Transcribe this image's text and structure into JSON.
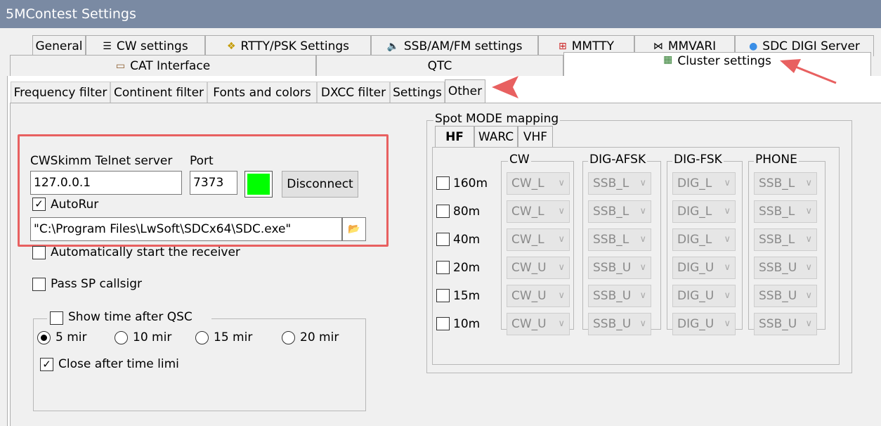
{
  "window": {
    "title": "5MContest Settings"
  },
  "tabs_row1": [
    {
      "label": "General",
      "icon": "",
      "icon_name": ""
    },
    {
      "label": "CW settings",
      "icon": "☰",
      "icon_name": "cw-settings-icon"
    },
    {
      "label": "RTTY/PSK Settings",
      "icon": "❖",
      "icon_name": "rtty-psk-icon"
    },
    {
      "label": "SSB/AM/FM settings",
      "icon": "🔈",
      "icon_name": "speaker-icon"
    },
    {
      "label": "MMTTY",
      "icon": "⊞",
      "icon_name": "mmtty-icon"
    },
    {
      "label": "MMVARI",
      "icon": "⋈",
      "icon_name": "mmvari-icon"
    },
    {
      "label": "SDC DIGI Server",
      "icon": "●",
      "icon_name": "sdc-digi-icon"
    }
  ],
  "tabs_row2": [
    {
      "label": "CAT Interface",
      "icon": "▭",
      "icon_name": "cat-interface-icon"
    },
    {
      "label": "QTC",
      "icon": "",
      "icon_name": ""
    },
    {
      "label": "Cluster settings",
      "icon": "▦",
      "icon_name": "cluster-settings-icon"
    }
  ],
  "subtabs": [
    "Frequency filter",
    "Continent filter",
    "Fonts and colors",
    "DXCC filter",
    "Settings",
    "Other"
  ],
  "other": {
    "server_label": "CWSkimm Telnet server",
    "port_label": "Port",
    "server_value": "127.0.0.1",
    "port_value": "7373",
    "status_color": "#00ff00",
    "disconnect_label": "Disconnect",
    "autorun_label": "AutoRur",
    "autorun_checked": "✓",
    "exe_path": "\"C:\\Program Files\\LwSoft\\SDCx64\\SDC.exe\"",
    "folder_icon": "📂",
    "auto_start_label": "Automatically start the receiver",
    "pass_sp_label": "Pass SP callsigr",
    "show_time_label": "Show time after QSC",
    "radio_options": [
      "5 mir",
      "10 mir",
      "15 mir",
      "20 mir"
    ],
    "close_after_label": "Close after time limi",
    "close_after_checked": "✓"
  },
  "spot_mode": {
    "title": "Spot MODE mapping",
    "tabs": [
      "HF",
      "WARC",
      "VHF"
    ],
    "columns": [
      "CW",
      "DIG-AFSK",
      "DIG-FSK",
      "PHONE"
    ],
    "bands": [
      {
        "band": "160m",
        "values": [
          "CW_L",
          "SSB_L",
          "DIG_L",
          "SSB_L"
        ]
      },
      {
        "band": "80m",
        "values": [
          "CW_L",
          "SSB_L",
          "DIG_L",
          "SSB_L"
        ]
      },
      {
        "band": "40m",
        "values": [
          "CW_L",
          "SSB_L",
          "DIG_L",
          "SSB_L"
        ]
      },
      {
        "band": "20m",
        "values": [
          "CW_U",
          "SSB_U",
          "DIG_U",
          "SSB_U"
        ]
      },
      {
        "band": "15m",
        "values": [
          "CW_U",
          "SSB_U",
          "DIG_U",
          "SSB_U"
        ]
      },
      {
        "band": "10m",
        "values": [
          "CW_U",
          "SSB_U",
          "DIG_U",
          "SSB_U"
        ]
      }
    ]
  },
  "colors": {
    "annotation": "#e86060"
  }
}
